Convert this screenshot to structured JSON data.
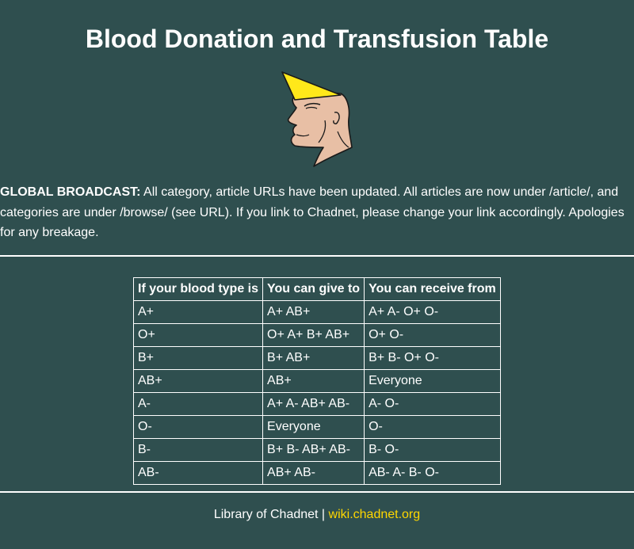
{
  "page": {
    "title": "Blood Donation and Transfusion Table"
  },
  "logo": {
    "icon": "chad-face-icon",
    "colors": {
      "hat": "#ffe81a",
      "skin": "#e8bfa5",
      "outline": "#1a1a1a"
    }
  },
  "broadcast": {
    "label": "GLOBAL BROADCAST:",
    "text": " All category, article URLs have been updated. All articles are now under /article/, and categories are under /browse/ (see URL). If you link to Chadnet, please change your link accordingly. Apologies for any breakage."
  },
  "table": {
    "headers": [
      "If your blood type is",
      "You can give to",
      "You can receive from"
    ],
    "rows": [
      [
        "A+",
        "A+ AB+",
        "A+ A- O+ O-"
      ],
      [
        "O+",
        "O+ A+ B+ AB+",
        "O+ O-"
      ],
      [
        "B+",
        "B+ AB+",
        "B+ B- O+ O-"
      ],
      [
        "AB+",
        "AB+",
        "Everyone"
      ],
      [
        "A-",
        "A+ A- AB+ AB-",
        "A- O-"
      ],
      [
        "O-",
        "Everyone",
        "O-"
      ],
      [
        "B-",
        "B+ B- AB+ AB-",
        "B- O-"
      ],
      [
        "AB-",
        "AB+ AB-",
        "AB- A- B- O-"
      ]
    ]
  },
  "footer": {
    "text": "Library of Chadnet | ",
    "link_text": "wiki.chadnet.org",
    "link_color": "#ffd700"
  },
  "colors": {
    "background": "#2f4f4f",
    "text": "#ffffff"
  }
}
